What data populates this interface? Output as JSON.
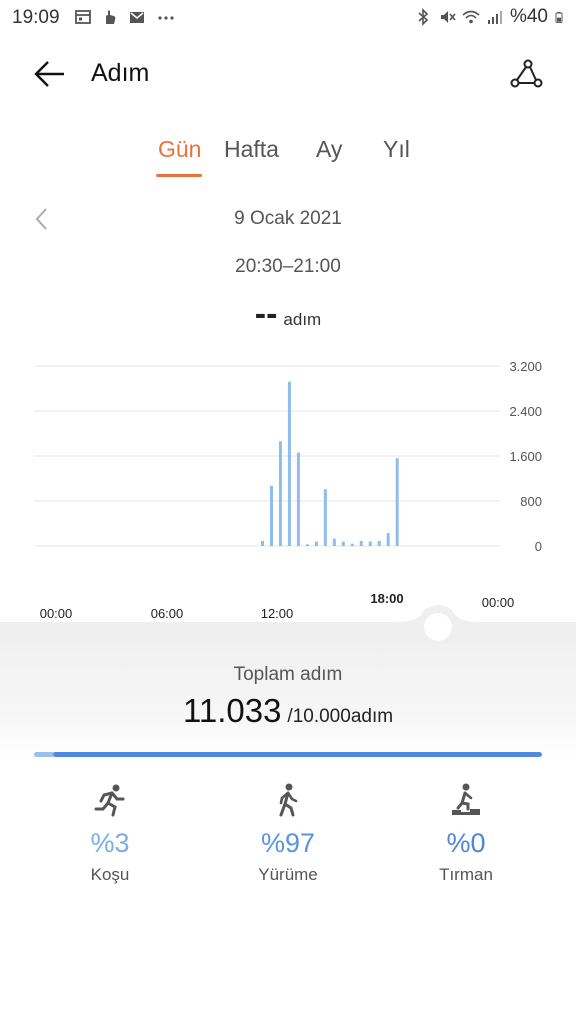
{
  "status_bar": {
    "time": "19:09",
    "battery_text": "%40",
    "left_icons": [
      "calendar-icon",
      "hand-icon",
      "mail-icon",
      "more-dots-icon"
    ],
    "right_icons": [
      "bluetooth-icon",
      "mute-icon",
      "wifi-icon",
      "signal-icon"
    ]
  },
  "header": {
    "title": "Adım",
    "back_icon": "arrow-left-icon",
    "action_icon": "route-icon"
  },
  "tabs": [
    {
      "label": "Gün",
      "active": true
    },
    {
      "label": "Hafta",
      "active": false
    },
    {
      "label": "Ay",
      "active": false
    },
    {
      "label": "Yıl",
      "active": false
    }
  ],
  "date": {
    "day": "9 Ocak 2021",
    "range": "20:30–21:00",
    "prev_icon": "chevron-left-icon"
  },
  "selected": {
    "value": "--",
    "unit": "adım"
  },
  "chart_data": {
    "type": "bar",
    "y_ticks": [
      "3.200",
      "2.400",
      "1.600",
      "800",
      "0"
    ],
    "y_values": [
      3200,
      2400,
      1600,
      800,
      0
    ],
    "ylim": [
      0,
      3200
    ],
    "x_ticks": [
      {
        "label": "00:00",
        "hour": 0,
        "bold": false
      },
      {
        "label": "06:00",
        "hour": 6,
        "bold": false
      },
      {
        "label": "12:00",
        "hour": 12,
        "bold": false
      },
      {
        "label": "18:00",
        "hour": 18,
        "bold": true
      },
      {
        "label": "00:00",
        "hour": 24,
        "bold": false
      }
    ],
    "selected_hour": 20.5,
    "bar_color": "#8fbdec",
    "bars": [
      {
        "hour": 12.0,
        "value": 90
      },
      {
        "hour": 12.5,
        "value": 1070
      },
      {
        "hour": 13.0,
        "value": 1860
      },
      {
        "hour": 13.5,
        "value": 2920
      },
      {
        "hour": 14.0,
        "value": 1660
      },
      {
        "hour": 14.5,
        "value": 30
      },
      {
        "hour": 15.0,
        "value": 80
      },
      {
        "hour": 15.5,
        "value": 1010
      },
      {
        "hour": 16.0,
        "value": 130
      },
      {
        "hour": 16.5,
        "value": 80
      },
      {
        "hour": 17.0,
        "value": 40
      },
      {
        "hour": 17.5,
        "value": 90
      },
      {
        "hour": 18.0,
        "value": 80
      },
      {
        "hour": 18.5,
        "value": 90
      },
      {
        "hour": 19.0,
        "value": 230
      },
      {
        "hour": 19.5,
        "value": 1560
      }
    ]
  },
  "summary": {
    "label": "Toplam adım",
    "value": "11.033",
    "goal": "/10.000adım",
    "progress_fraction": 1.0,
    "progress_color": "#4f8ae0"
  },
  "activities": [
    {
      "icon": "running-icon",
      "percent": "%3",
      "label": "Koşu",
      "color": "#7aaee8"
    },
    {
      "icon": "walking-icon",
      "percent": "%97",
      "label": "Yürüme",
      "color": "#5b93df"
    },
    {
      "icon": "climbing-icon",
      "percent": "%0",
      "label": "Tırman",
      "color": "#4f86d6"
    }
  ]
}
